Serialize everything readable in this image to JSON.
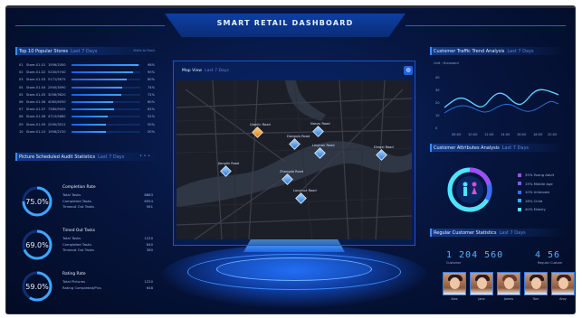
{
  "header": {
    "title": "SMART RETAIL DASHBOARD"
  },
  "top_stores": {
    "title": "Top 10 Popular Stores",
    "subtitle": "Last 7 Days",
    "right_note": "Visits to Rank",
    "rows": [
      {
        "rank": "01",
        "name": "Store-01-01",
        "value": "1956/2000",
        "percent": "98%",
        "fill": 0.98
      },
      {
        "rank": "02",
        "name": "Store-01-02",
        "value": "5200/5740",
        "percent": "90%",
        "fill": 0.9
      },
      {
        "rank": "03",
        "name": "Store-01-03",
        "value": "5171/5675",
        "percent": "80%",
        "fill": 0.8
      },
      {
        "rank": "04",
        "name": "Store-01-04",
        "value": "2900/3090",
        "percent": "74%",
        "fill": 0.74
      },
      {
        "rank": "05",
        "name": "Store-01-05",
        "value": "3056/3620",
        "percent": "72%",
        "fill": 0.72
      },
      {
        "rank": "06",
        "name": "Store-01-06",
        "value": "4060/6050",
        "percent": "60%",
        "fill": 0.6
      },
      {
        "rank": "07",
        "name": "Store-01-07",
        "value": "7380/9005",
        "percent": "62%",
        "fill": 0.62
      },
      {
        "rank": "08",
        "name": "Store-01-08",
        "value": "4715/5860",
        "percent": "52%",
        "fill": 0.52
      },
      {
        "rank": "09",
        "name": "Store-01-09",
        "value": "2090/3012",
        "percent": "50%",
        "fill": 0.5
      },
      {
        "rank": "10",
        "name": "Store-01-10",
        "value": "1956/2150",
        "percent": "50%",
        "fill": 0.5
      }
    ]
  },
  "audit": {
    "title": "Picture Scheduled Audit Statistics",
    "subtitle": "Last 7 Days",
    "blocks": [
      {
        "percent_label": "75.0%",
        "percent": 0.75,
        "title": "Completion Rate",
        "rows": [
          {
            "k": "Total Tasks",
            "v": "8863"
          },
          {
            "k": "Completed Tasks",
            "v": "6554"
          },
          {
            "k": "Timeout Out Tasks",
            "v": "561"
          }
        ]
      },
      {
        "percent_label": "69.0%",
        "percent": 0.69,
        "title": "Timed Out Tasks",
        "rows": [
          {
            "k": "Total Tasks",
            "v": "1220"
          },
          {
            "k": "Completed Tasks",
            "v": "840"
          },
          {
            "k": "Timeout Out Tasks",
            "v": "380"
          }
        ]
      },
      {
        "percent_label": "59.0%",
        "percent": 0.59,
        "title": "Rating Rate",
        "rows": [
          {
            "k": "Total Pictures",
            "v": "1220"
          },
          {
            "k": "Rating Completed/Pics",
            "v": "648"
          }
        ]
      }
    ]
  },
  "map": {
    "title": "Map View",
    "subtitle": "Last 7 Days",
    "pins": [
      {
        "label": "Qianlin Road",
        "hot": true
      },
      {
        "label": "Dongqiu Road",
        "hot": false
      },
      {
        "label": "Nanzu Road",
        "hot": false
      },
      {
        "label": "Lingnan Road",
        "hot": false
      },
      {
        "label": "Dingxi Road",
        "hot": false
      },
      {
        "label": "Jianglin Road",
        "hot": false
      },
      {
        "label": "Zhongda Road",
        "hot": false
      },
      {
        "label": "Longhua Road",
        "hot": false
      }
    ]
  },
  "traffic": {
    "title": "Customer Traffic Trend Analysis",
    "subtitle": "Last 7 Days",
    "unit": "Unit : thousand",
    "y_ticks": [
      "40",
      "30",
      "20",
      "10",
      "0"
    ],
    "x_ticks": [
      "08:00",
      "10:00",
      "12:00",
      "14:00",
      "16:00",
      "18:00",
      "20:00"
    ]
  },
  "attributes": {
    "title": "Customer Attributes Analysis",
    "subtitle": "Last 7 Days",
    "legend": [
      {
        "label": "35%  Young Adult",
        "color": "#a24bff"
      },
      {
        "label": "15%  Middle Age",
        "color": "#7a5cff"
      },
      {
        "label": "10%  Unknown",
        "color": "#3b6dff"
      },
      {
        "label": "18%  Child",
        "color": "#2fb0ff"
      },
      {
        "label": "40%  Elderly",
        "color": "#4ee3ff"
      }
    ]
  },
  "regular": {
    "title": "Regular Customer Statistics",
    "subtitle": "Last 7 Days",
    "count_a": "1 204 560",
    "count_a_label": "Customer",
    "count_b": "4 56",
    "count_b_label": "Regular Custom",
    "people": [
      "Alex",
      "Jane",
      "James",
      "Tom",
      "Amy"
    ]
  }
}
